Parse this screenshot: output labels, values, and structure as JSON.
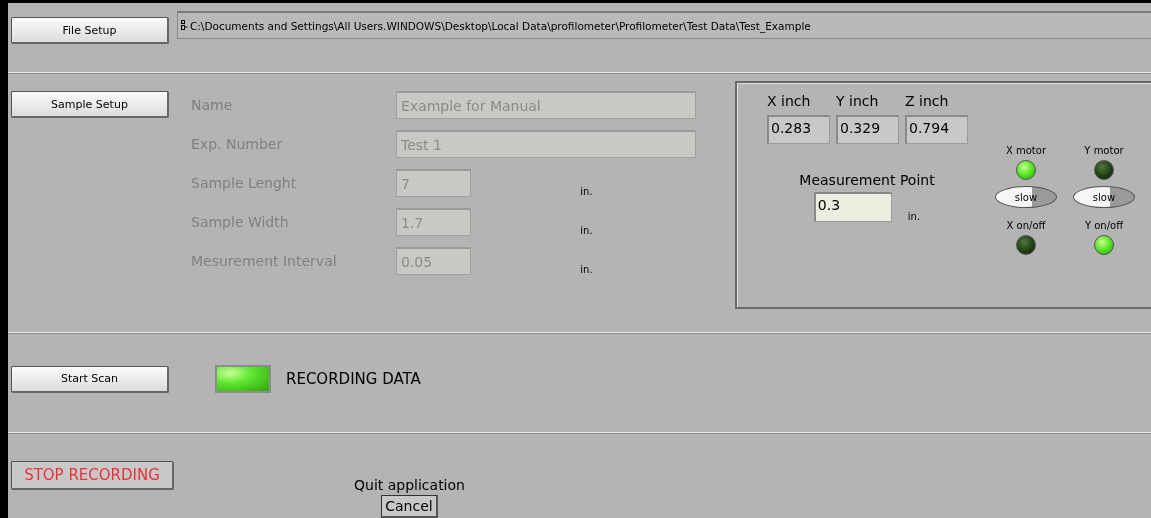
{
  "file_setup": {
    "button": "File Setup",
    "path": "C:\\Documents and Settings\\All Users.WINDOWS\\Desktop\\Local Data\\profilometer\\Profilometer\\Test Data\\Test_Example"
  },
  "sample_setup": {
    "button": "Sample Setup",
    "fields": [
      {
        "label": "Name",
        "value": "Example for Manual",
        "kind": "wide",
        "disabled": true
      },
      {
        "label": "Exp. Number",
        "value": "Test 1",
        "kind": "wide",
        "disabled": true
      },
      {
        "label": "Sample Lenght",
        "value": "7",
        "unit": "in.",
        "kind": "short",
        "disabled": true
      },
      {
        "label": "Sample Width",
        "value": "1.7",
        "unit": "in.",
        "kind": "short",
        "disabled": true
      },
      {
        "label": "Mesurement Interval",
        "value": "0.05",
        "unit": "in.",
        "kind": "short",
        "disabled": true
      }
    ]
  },
  "position": {
    "axes": [
      {
        "label": "X inch",
        "value": "0.283"
      },
      {
        "label": "Y inch",
        "value": "0.329"
      },
      {
        "label": "Z inch",
        "value": "0.794"
      }
    ],
    "measurement_point": {
      "label": "Measurement Point",
      "value": "0.3",
      "unit": "in."
    },
    "motors": [
      {
        "label": "X motor",
        "on": true,
        "switch": "slow",
        "switch_on": false,
        "power_label": "X on/off",
        "power_on": false
      },
      {
        "label": "Y motor",
        "on": false,
        "switch": "slow",
        "switch_on": false,
        "power_label": "Y on/off",
        "power_on": true
      }
    ]
  },
  "scan": {
    "button": "Start Scan",
    "indicator": {
      "label": "RECORDING DATA",
      "on": true
    }
  },
  "stop": {
    "button": "STOP RECORDING",
    "quit_label": "Quit application",
    "cancel": "Cancel"
  }
}
